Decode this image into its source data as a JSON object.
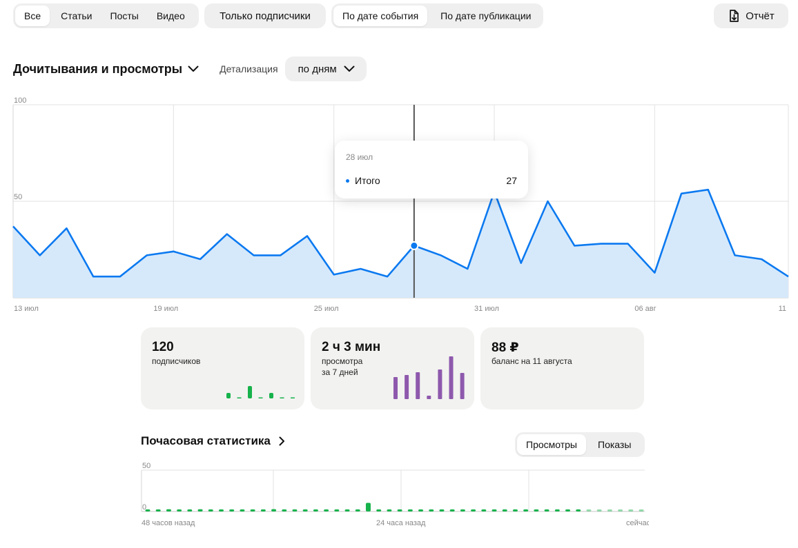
{
  "filters": {
    "type_tabs": [
      {
        "label": "Все",
        "active": true
      },
      {
        "label": "Статьи",
        "active": false
      },
      {
        "label": "Посты",
        "active": false
      },
      {
        "label": "Видео",
        "active": false
      }
    ],
    "subscribers_only": "Только подписчики",
    "date_tabs": [
      {
        "label": "По дате события",
        "active": true
      },
      {
        "label": "По дате публикации",
        "active": false
      }
    ],
    "report_button": "Отчёт",
    "report_icon": "file-download-icon"
  },
  "chart_section": {
    "title": "Дочитывания и просмотры",
    "detail_label": "Детализация",
    "detail_value": "по дням"
  },
  "chart_data": [
    {
      "type": "area",
      "series": [
        {
          "name": "Итого",
          "color": "#0b79f0",
          "fill": "#d6e9fb",
          "values": [
            37,
            22,
            36,
            11,
            11,
            22,
            24,
            20,
            33,
            22,
            22,
            32,
            12,
            15,
            11,
            27,
            22,
            15,
            55,
            18,
            50,
            27,
            28,
            28,
            13,
            54,
            56,
            22,
            20,
            11
          ]
        }
      ],
      "x_tick_labels": [
        "13 июл",
        "19 июл",
        "25 июл",
        "31 июл",
        "06 авг",
        "11"
      ],
      "x_tick_indices": [
        0,
        6,
        12,
        18,
        24,
        29
      ],
      "y_ticks": [
        0,
        50,
        100
      ],
      "ylim": [
        0,
        100
      ],
      "grid": true,
      "hover": {
        "index": 15,
        "date": "28 июл",
        "series": "Итого",
        "value": "27"
      }
    },
    {
      "type": "bar",
      "series": [
        {
          "name": "",
          "color": "#16b24b",
          "values": [
            1.2,
            1.1,
            1.4,
            1.1,
            1.1,
            1.4,
            1.3,
            1.1,
            1.2,
            1.1,
            1.2,
            1.3,
            1.5,
            1.2,
            1.1,
            1.2,
            1.1,
            1.2,
            1.1,
            1.2,
            1.1,
            1.2,
            1.1,
            1.1,
            1.1,
            1.2,
            1.1,
            1.2,
            1.1,
            1.2,
            1.1,
            1.1,
            1.1,
            1.1,
            1.1,
            1.1,
            1.2,
            1.1,
            1.1,
            1.2,
            1.1,
            1.2,
            1.1,
            1.2,
            1.1,
            1.2,
            1.1,
            1.2
          ]
        }
      ],
      "faded_from_index": 42,
      "highlight": {
        "index": 21,
        "value": 5.5
      },
      "y_ticks": [
        0,
        50
      ],
      "ylim": [
        0,
        50
      ],
      "x_tick_labels": [
        "48 часов назад",
        "24 часа назад",
        "сейчас"
      ],
      "grid": true
    }
  ],
  "cards": [
    {
      "value": "120",
      "label": [
        "подписчиков"
      ],
      "mini_chart": {
        "color": "#16b24b",
        "values": [
          8,
          0,
          18,
          0,
          8,
          0,
          0
        ],
        "zero_marks": true
      }
    },
    {
      "value": "2 ч 3 мин",
      "label": [
        "просмотра",
        "за 7 дней"
      ],
      "mini_chart": {
        "color": "#8e59ad",
        "values": [
          32,
          35,
          39,
          5,
          43,
          62,
          38
        ]
      }
    },
    {
      "value": "88 ₽",
      "label": [
        "баланс на 11 августа"
      ]
    }
  ],
  "hourly": {
    "title": "Почасовая статистика",
    "tabs": [
      {
        "label": "Просмотры",
        "active": true
      },
      {
        "label": "Показы",
        "active": false
      }
    ]
  }
}
